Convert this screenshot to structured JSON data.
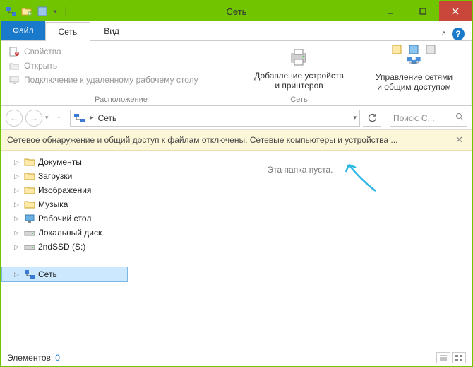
{
  "window": {
    "title": "Сеть"
  },
  "tabs": {
    "file": "Файл",
    "network": "Сеть",
    "view": "Вид"
  },
  "ribbon": {
    "location": {
      "label": "Расположение",
      "properties": "Свойства",
      "open": "Открыть",
      "rdp": "Подключение к удаленному рабочему столу"
    },
    "network": {
      "label": "Сеть",
      "add_devices_l1": "Добавление устройств",
      "add_devices_l2": "и принтеров",
      "manage_l1": "Управление сетями",
      "manage_l2": "и общим доступом"
    }
  },
  "address": {
    "crumb": "Сеть"
  },
  "search": {
    "placeholder": "Поиск: С..."
  },
  "infobar": {
    "text": "Сетевое обнаружение и общий доступ к файлам отключены. Сетевые компьютеры и устройства ..."
  },
  "tree": {
    "documents": "Документы",
    "downloads": "Загрузки",
    "pictures": "Изображения",
    "music": "Музыка",
    "desktop": "Рабочий стол",
    "localdisk": "Локальный диск",
    "ssd": "2ndSSD (S:)",
    "network": "Сеть"
  },
  "content": {
    "empty": "Эта папка пуста."
  },
  "status": {
    "label": "Элементов:",
    "count": "0"
  }
}
